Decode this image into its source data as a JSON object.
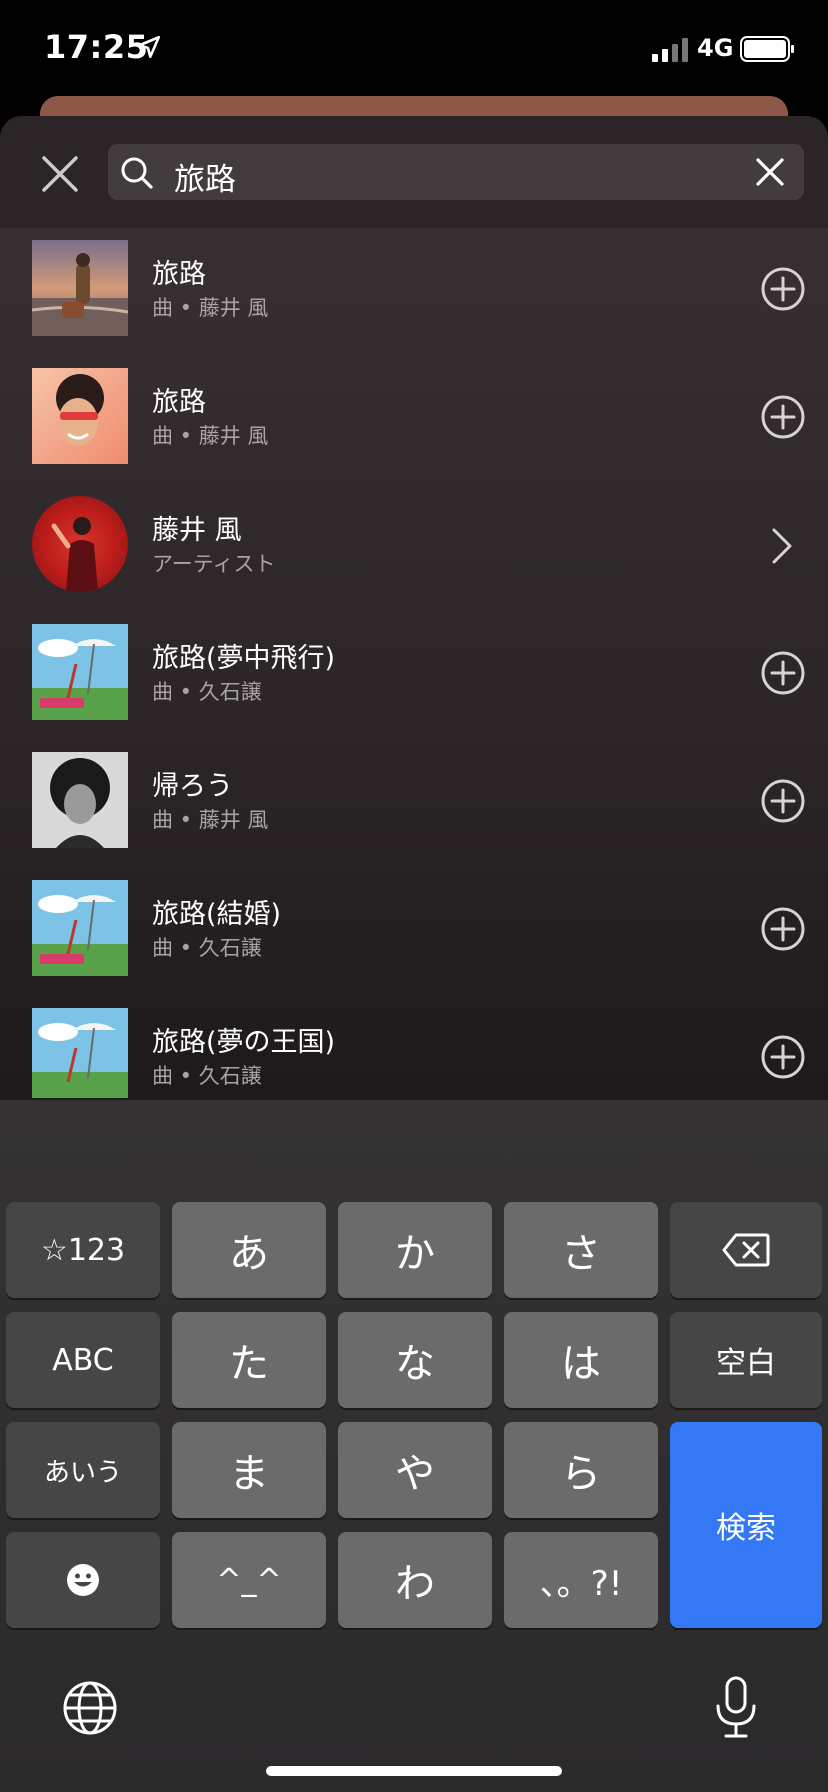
{
  "status_bar": {
    "time": "17:25",
    "network": "4G"
  },
  "search": {
    "query": "旅路"
  },
  "results": [
    {
      "title": "旅路",
      "subtitle": "曲 • 藤井 風",
      "action": "add",
      "thumb": "beach"
    },
    {
      "title": "旅路",
      "subtitle": "曲 • 藤井 風",
      "action": "add",
      "thumb": "portrait"
    },
    {
      "title": "藤井 風",
      "subtitle": "アーティスト",
      "action": "open",
      "thumb": "artist"
    },
    {
      "title": "旅路(夢中飛行)",
      "subtitle": "曲 • 久石譲",
      "action": "add",
      "thumb": "anime"
    },
    {
      "title": "帰ろう",
      "subtitle": "曲 • 藤井 風",
      "action": "add",
      "thumb": "bw"
    },
    {
      "title": "旅路(結婚)",
      "subtitle": "曲 • 久石譲",
      "action": "add",
      "thumb": "anime"
    },
    {
      "title": "旅路(夢の王国)",
      "subtitle": "曲 • 久石譲",
      "action": "add",
      "thumb": "anime"
    }
  ],
  "keyboard": {
    "row1": [
      "☆123",
      "あ",
      "か",
      "さ"
    ],
    "row2": [
      "ABC",
      "た",
      "な",
      "は",
      "空白"
    ],
    "row3": [
      "あいう",
      "ま",
      "や",
      "ら"
    ],
    "row4": [
      "^_^",
      "わ",
      "、。?!"
    ],
    "search_key": "検索"
  },
  "colors": {
    "accent": "#3478f6",
    "card_peek": "#8d5848"
  }
}
